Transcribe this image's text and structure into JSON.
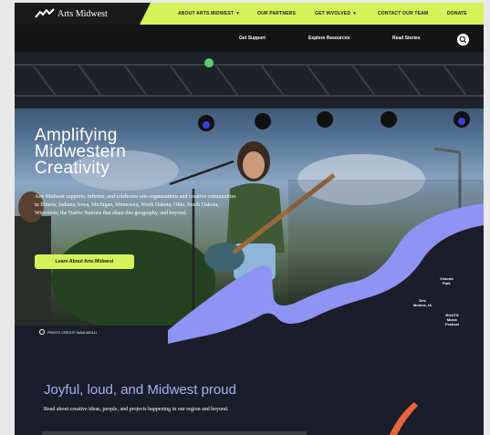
{
  "brand": {
    "name": "Arts Midwest"
  },
  "top_nav": {
    "items": [
      {
        "label": "ABOUT ARTS MIDWEST",
        "caret": "▾"
      },
      {
        "label": "OUR PARTNERS",
        "caret": ""
      },
      {
        "label": "GET INVOLVED",
        "caret": "▾"
      },
      {
        "label": "CONTACT OUR TEAM",
        "caret": ""
      },
      {
        "label": "DONATE",
        "caret": ""
      }
    ]
  },
  "sub_nav": {
    "items": [
      "Get Support",
      "Explore Resources",
      "Read Stories"
    ],
    "search_icon": "search-icon"
  },
  "hero": {
    "title": "Amplifying Midwestern Creativity",
    "description": "Arts Midwest supports, informs, and celebrates arts organizations and creative communities in Illinois, Indiana, Iowa, Michigan, Minnesota, North Dakota, Ohio, South Dakota, Wisconsin, the Native Nations that share this geography, and beyond.",
    "cta_label": "Learn About Arts Midwest",
    "photo_credit": "PHOTO CREDIT: NAIA MOLLI"
  },
  "map_labels": {
    "victoria": "Victoria\nPark",
    "des_moines": "Des\nMoines, IA",
    "roots": "ROOTS\nMusic\nFestival"
  },
  "lower": {
    "title": "Joyful, loud, and Midwest proud",
    "subtitle": "Read about creative ideas, people, and projects happening in our region and beyond."
  },
  "colors": {
    "accent": "#d6f25a",
    "dark": "#1c1d2b",
    "periwinkle": "#8f93f3",
    "heading_lavender": "#a8aff5",
    "orange": "#e8643c"
  }
}
